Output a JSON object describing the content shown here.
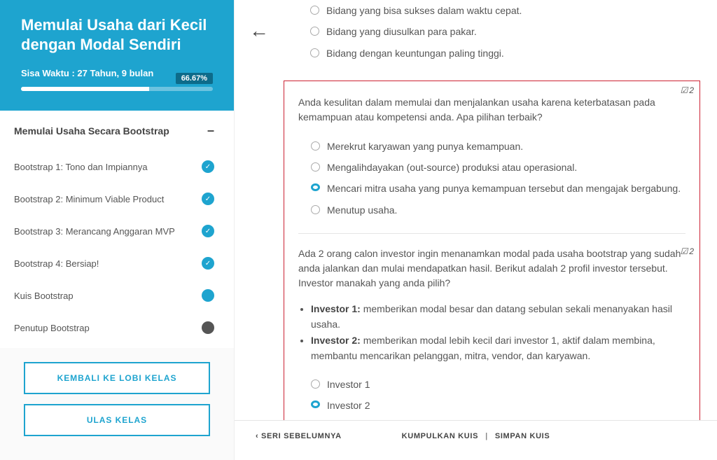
{
  "sidebar": {
    "title": "Memulai Usaha dari Kecil dengan Modal Sendiri",
    "time_label": "Sisa Waktu : 27 Tahun, 9 bulan",
    "progress": "66.67%",
    "section": "Memulai Usaha Secara Bootstrap",
    "items": [
      {
        "label": "Bootstrap 1: Tono dan Impiannya",
        "state": "check"
      },
      {
        "label": "Bootstrap 2: Minimum Viable Product",
        "state": "check"
      },
      {
        "label": "Bootstrap 3: Merancang Anggaran MVP",
        "state": "check"
      },
      {
        "label": "Bootstrap 4: Bersiap!",
        "state": "check"
      },
      {
        "label": "Kuis Bootstrap",
        "state": "cyan"
      },
      {
        "label": "Penutup Bootstrap",
        "state": "dark"
      }
    ],
    "lobby_btn": "KEMBALI KE LOBI KELAS",
    "review_btn": "ULAS KELAS"
  },
  "back_icon": "←",
  "q1": {
    "options": [
      "Bidang yang bisa sukses dalam waktu cepat.",
      "Bidang yang diusulkan para pakar.",
      "Bidang dengan keuntungan paling tinggi."
    ]
  },
  "q2": {
    "flag": "2",
    "prompt": "Anda kesulitan dalam memulai dan menjalankan usaha karena keterbatasan pada kemampuan atau kompetensi anda. Apa pilihan terbaik?",
    "options": [
      {
        "label": "Merekrut karyawan yang punya kemampuan.",
        "selected": false
      },
      {
        "label": "Mengalihdayakan (out-source) produksi atau operasional.",
        "selected": false
      },
      {
        "label": "Mencari mitra usaha yang punya kemampuan tersebut dan mengajak bergabung.",
        "selected": true
      },
      {
        "label": "Menutup usaha.",
        "selected": false
      }
    ]
  },
  "q3": {
    "flag": "2",
    "prompt": "Ada 2 orang calon investor ingin menanamkan modal pada usaha bootstrap yang sudah anda jalankan dan mulai mendapatkan hasil. Berikut adalah 2 profil investor tersebut. Investor manakah yang anda pilih?",
    "inv1_name": "Investor 1:",
    "inv1_desc": " memberikan modal besar dan datang sebulan sekali menanyakan hasil usaha.",
    "inv2_name": "Investor 2:",
    "inv2_desc": " memberikan modal lebih kecil dari investor 1, aktif dalam membina, membantu mencarikan pelanggan, mitra, vendor, dan karyawan.",
    "options": [
      {
        "label": "Investor 1",
        "selected": false
      },
      {
        "label": "Investor 2",
        "selected": true
      }
    ]
  },
  "bottom": {
    "prev": "SERI SEBELUMNYA",
    "collect": "KUMPULKAN KUIS",
    "save": "SIMPAN KUIS"
  }
}
